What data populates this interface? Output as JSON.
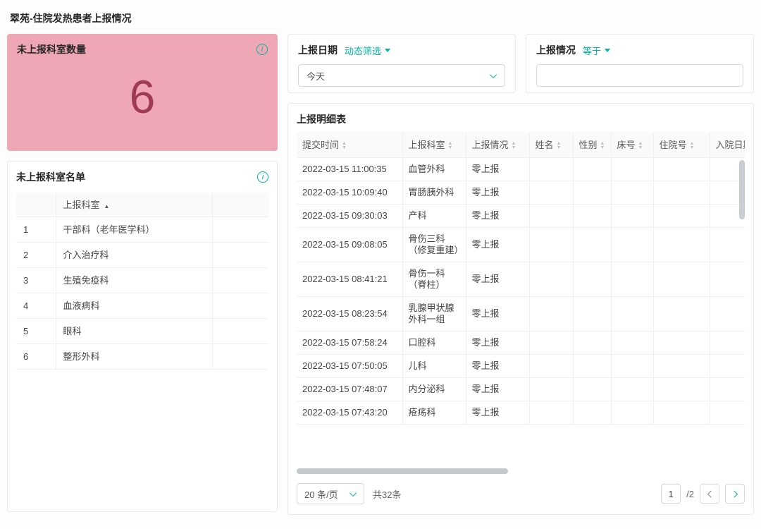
{
  "colors": {
    "accent": "#00b4a0",
    "summary_bg": "#f0a7b5",
    "summary_value": "#9e3a52"
  },
  "icons": {
    "info": "circled-i",
    "caret_down": "▼",
    "sort_asc": "▲",
    "sorter": "▲▼",
    "chevron_down": "v",
    "chevron_left": "<",
    "chevron_right": ">"
  },
  "page": {
    "title": "翠苑-住院发热患者上报情况"
  },
  "summary_card": {
    "title": "未上报科室数量",
    "value": "6"
  },
  "dept_card": {
    "title": "未上报科室名单",
    "dept_column": "上报科室",
    "rows": [
      {
        "index": "1",
        "dept": "干部科（老年医学科）"
      },
      {
        "index": "2",
        "dept": "介入治疗科"
      },
      {
        "index": "3",
        "dept": "生殖免疫科"
      },
      {
        "index": "4",
        "dept": "血液病科"
      },
      {
        "index": "5",
        "dept": "眼科"
      },
      {
        "index": "6",
        "dept": "整形外科"
      }
    ]
  },
  "filters": {
    "date": {
      "label": "上报日期",
      "mode": "动态筛选",
      "value": "今天"
    },
    "status": {
      "label": "上报情况",
      "mode": "等于",
      "value": ""
    }
  },
  "detail": {
    "title": "上报明细表",
    "columns": [
      "提交时间",
      "上报科室",
      "上报情况",
      "姓名",
      "性别",
      "床号",
      "住院号",
      "入院日期"
    ],
    "rows": [
      {
        "time": "2022-03-15 11:00:35",
        "dept": "血管外科",
        "status": "零上报",
        "name": "",
        "sex": "",
        "bed": "",
        "admission_no": "",
        "admit_date": ""
      },
      {
        "time": "2022-03-15 10:09:40",
        "dept": "胃肠胰外科",
        "status": "零上报",
        "name": "",
        "sex": "",
        "bed": "",
        "admission_no": "",
        "admit_date": ""
      },
      {
        "time": "2022-03-15 09:30:03",
        "dept": "产科",
        "status": "零上报",
        "name": "",
        "sex": "",
        "bed": "",
        "admission_no": "",
        "admit_date": ""
      },
      {
        "time": "2022-03-15 09:08:05",
        "dept": "骨伤三科（修复重建）",
        "status": "零上报",
        "name": "",
        "sex": "",
        "bed": "",
        "admission_no": "",
        "admit_date": ""
      },
      {
        "time": "2022-03-15 08:41:21",
        "dept": "骨伤一科（脊柱）",
        "status": "零上报",
        "name": "",
        "sex": "",
        "bed": "",
        "admission_no": "",
        "admit_date": ""
      },
      {
        "time": "2022-03-15 08:23:54",
        "dept": "乳腺甲状腺外科一组",
        "status": "零上报",
        "name": "",
        "sex": "",
        "bed": "",
        "admission_no": "",
        "admit_date": ""
      },
      {
        "time": "2022-03-15 07:58:24",
        "dept": "口腔科",
        "status": "零上报",
        "name": "",
        "sex": "",
        "bed": "",
        "admission_no": "",
        "admit_date": ""
      },
      {
        "time": "2022-03-15 07:50:05",
        "dept": "儿科",
        "status": "零上报",
        "name": "",
        "sex": "",
        "bed": "",
        "admission_no": "",
        "admit_date": ""
      },
      {
        "time": "2022-03-15 07:48:07",
        "dept": "内分泌科",
        "status": "零上报",
        "name": "",
        "sex": "",
        "bed": "",
        "admission_no": "",
        "admit_date": ""
      },
      {
        "time": "2022-03-15 07:43:20",
        "dept": "疮疡科",
        "status": "零上报",
        "name": "",
        "sex": "",
        "bed": "",
        "admission_no": "",
        "admit_date": ""
      }
    ],
    "footer": {
      "page_size": "20 条/页",
      "total": "共32条",
      "current_page": "1",
      "page_suffix": "/2"
    }
  }
}
